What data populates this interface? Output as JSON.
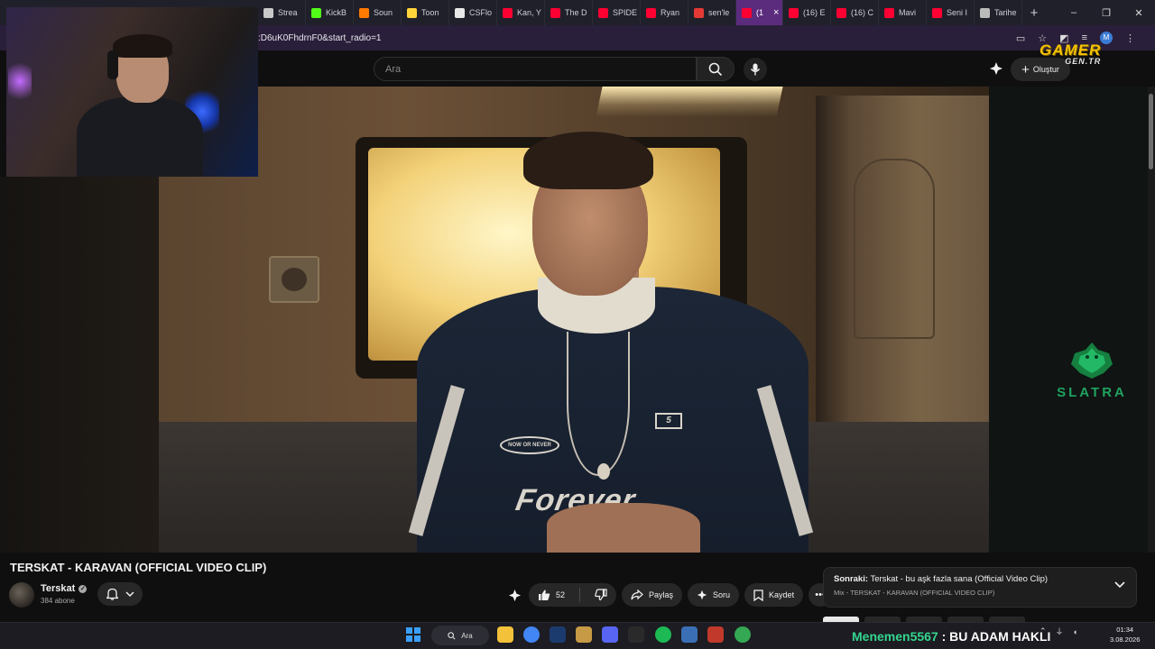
{
  "browser": {
    "tabs": [
      {
        "label": "Strea",
        "icon": "stream-icon",
        "color": "#c9c9c9"
      },
      {
        "label": "KickB",
        "icon": "kick-icon",
        "color": "#53fc18"
      },
      {
        "label": "Soun",
        "icon": "soundcloud-icon",
        "color": "#ff7a00"
      },
      {
        "label": "Toon",
        "icon": "toon-icon",
        "color": "#ffd43b"
      },
      {
        "label": "CSFlo",
        "icon": "csfloat-icon",
        "color": "#e8e8e8"
      },
      {
        "label": "Kan, Y",
        "icon": "youtube-icon",
        "color": "#ff0033"
      },
      {
        "label": "The D",
        "icon": "youtube-icon",
        "color": "#ff0033"
      },
      {
        "label": "SPIDE",
        "icon": "youtube-icon",
        "color": "#ff0033"
      },
      {
        "label": "Ryan",
        "icon": "youtube-icon",
        "color": "#ff0033"
      },
      {
        "label": "sen'le",
        "icon": "sahibinden-icon",
        "color": "#e53935"
      },
      {
        "label": "(1",
        "icon": "youtube-icon",
        "color": "#ff0033",
        "active": true
      },
      {
        "label": "(16) E",
        "icon": "youtube-icon",
        "color": "#ff0033"
      },
      {
        "label": "(16) C",
        "icon": "youtube-icon",
        "color": "#ff0033"
      },
      {
        "label": "Mavi",
        "icon": "youtube-icon",
        "color": "#ff0033"
      },
      {
        "label": "Seni I",
        "icon": "youtube-icon",
        "color": "#ff0033"
      },
      {
        "label": "Tarihe",
        "icon": "history-icon",
        "color": "#bbbbbb"
      }
    ],
    "new_tab": "+",
    "url": ":D6uK0FhdrnF0&start_radio=1",
    "profile_initial": "M"
  },
  "youtube": {
    "search_placeholder": "Ara",
    "create_label": "Oluştur",
    "video_title": "TERSKAT - KARAVAN (OFFICIAL VIDEO CLIP)",
    "channel_name": "Terskat",
    "subscribers": "384 abone",
    "like_count": "52",
    "share_label": "Paylaş",
    "ask_label": "Soru",
    "save_label": "Kaydet",
    "up_next_prefix": "Sonraki:",
    "up_next_title": "Terskat - bu aşk fazla sana (Official Video Clip)",
    "mix_label": "Mix - TERSKAT - KARAVAN (OFFICIAL VIDEO CLIP)"
  },
  "video_overlay": {
    "badge_text": "NOW OR NEVER",
    "jersey_number": "5",
    "jersey_text": "Forever"
  },
  "overlays": {
    "gamer_logo_top": "GAMER",
    "gamer_logo_bottom": "GEN.TR",
    "sponsor": "SLATRA"
  },
  "taskbar": {
    "search_label": "Ara",
    "ticker_user": "Menemen5567",
    "ticker_message": ": BU ADAM HAKLI",
    "time": "01:34",
    "date": "3.08.2026"
  }
}
